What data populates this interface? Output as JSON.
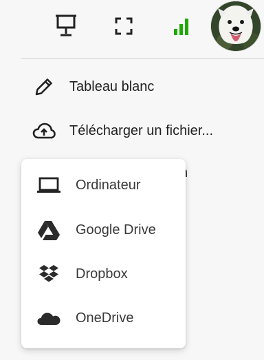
{
  "toolbar": {
    "icons": [
      "presentation-icon",
      "fullscreen-icon",
      "signal-icon",
      "avatar"
    ],
    "signal_color": "#1faa00"
  },
  "menu": {
    "whiteboard_label": "Tableau blanc",
    "upload_label": "Télécharger un fichier...",
    "peek_text": "n"
  },
  "dropdown": {
    "items": [
      {
        "label": "Ordinateur",
        "icon": "laptop-icon"
      },
      {
        "label": "Google Drive",
        "icon": "google-drive-icon"
      },
      {
        "label": "Dropbox",
        "icon": "dropbox-icon"
      },
      {
        "label": "OneDrive",
        "icon": "onedrive-icon"
      }
    ]
  }
}
